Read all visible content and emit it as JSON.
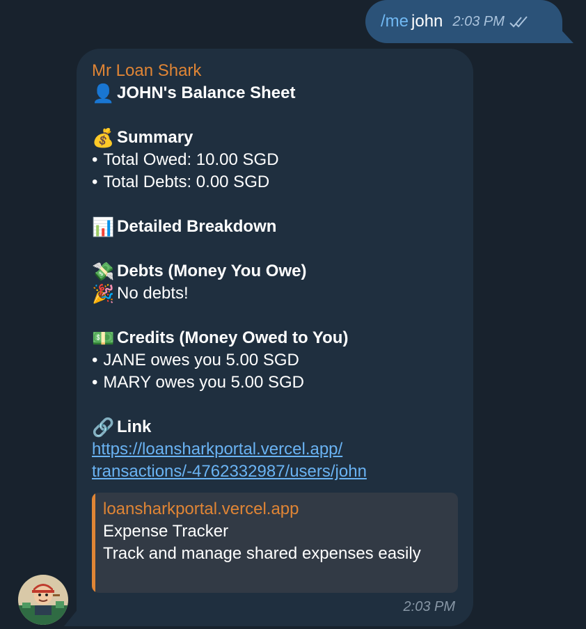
{
  "outgoing_message": {
    "command": "/me",
    "text": "john",
    "time": "2:03 PM",
    "status_icon": "double-check-icon"
  },
  "incoming_message": {
    "sender": "Mr Loan Shark",
    "header": {
      "icon": "👤",
      "text": "JOHN's Balance Sheet"
    },
    "summary": {
      "icon": "💰",
      "title": "Summary",
      "items": [
        "Total Owed: 10.00 SGD",
        "Total Debts: 0.00 SGD"
      ]
    },
    "breakdown": {
      "icon": "📊",
      "title": "Detailed Breakdown"
    },
    "debts": {
      "icon": "💸",
      "title": "Debts (Money You Owe)",
      "empty_icon": "🎉",
      "empty_text": "No debts!"
    },
    "credits": {
      "icon": "💵",
      "title": "Credits (Money Owed to You)",
      "items": [
        "JANE owes you 5.00 SGD",
        "MARY owes you 5.00 SGD"
      ]
    },
    "link_section": {
      "icon": "🔗",
      "title": "Link",
      "url_line1": "https://loansharkportal.vercel.app/",
      "url_line2": "transactions/-4762332987/users/john"
    },
    "preview": {
      "site": "loansharkportal.vercel.app",
      "title": "Expense Tracker",
      "description": "Track and manage shared expenses easily"
    },
    "time": "2:03 PM"
  },
  "colors": {
    "background": "#18222d",
    "outgoing_bubble": "#2b5278",
    "incoming_bubble": "#1f2f3f",
    "sender_accent": "#e08535",
    "link": "#6ab3f3"
  }
}
